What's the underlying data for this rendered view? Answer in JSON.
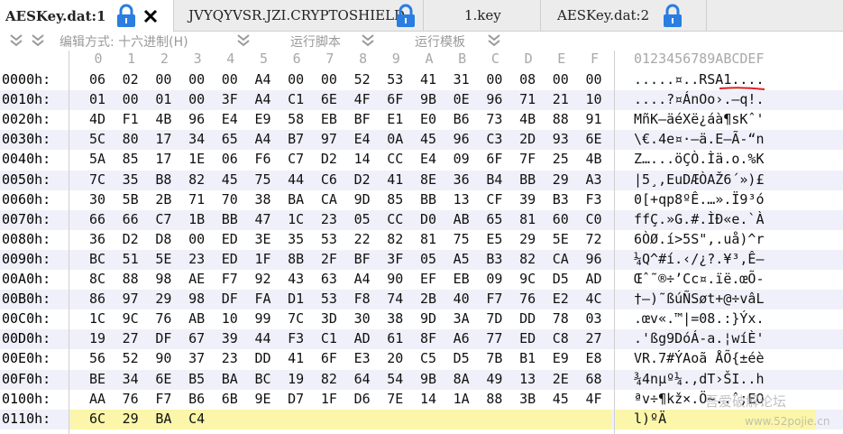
{
  "tabs": [
    {
      "label": "AESKey.dat:1",
      "active": true,
      "locked": true,
      "closable": true
    },
    {
      "label": "JVYQYVSR.JZI.CRYPTOSHIELD",
      "active": false,
      "locked": true
    },
    {
      "label": "1.key",
      "active": false,
      "locked": false
    },
    {
      "label": "AESKey.dat:2",
      "active": false,
      "locked": true
    }
  ],
  "toolbar": {
    "edit_mode": "编辑方式: 十六进制(H)",
    "run_script": "运行脚本",
    "run_template": "运行模板"
  },
  "column_header_hex": [
    "0",
    "1",
    "2",
    "3",
    "4",
    "5",
    "6",
    "7",
    "8",
    "9",
    "A",
    "B",
    "C",
    "D",
    "E",
    "F"
  ],
  "column_header_ascii": "0123456789ABCDEF",
  "rows": [
    {
      "offset": "0000h:",
      "hex": [
        "06",
        "02",
        "00",
        "00",
        "00",
        "A4",
        "00",
        "00",
        "52",
        "53",
        "41",
        "31",
        "00",
        "08",
        "00",
        "00"
      ],
      "ascii": ".....¤..RSA1...."
    },
    {
      "offset": "0010h:",
      "hex": [
        "01",
        "00",
        "01",
        "00",
        "3F",
        "A4",
        "C1",
        "6E",
        "4F",
        "6F",
        "9B",
        "0E",
        "96",
        "71",
        "21",
        "10"
      ],
      "ascii": "....?¤ÁnOo›.–q!."
    },
    {
      "offset": "0020h:",
      "hex": [
        "4D",
        "F1",
        "4B",
        "96",
        "E4",
        "E9",
        "58",
        "EB",
        "BF",
        "E1",
        "E0",
        "B6",
        "73",
        "4B",
        "88",
        "91"
      ],
      "ascii": "MñK–äéXë¿áà¶sKˆ'"
    },
    {
      "offset": "0030h:",
      "hex": [
        "5C",
        "80",
        "17",
        "34",
        "65",
        "A4",
        "B7",
        "97",
        "E4",
        "0A",
        "45",
        "96",
        "C3",
        "2D",
        "93",
        "6E"
      ],
      "ascii": "\\€.4e¤·—ä.E–Ã-“n"
    },
    {
      "offset": "0040h:",
      "hex": [
        "5A",
        "85",
        "17",
        "1E",
        "06",
        "F6",
        "C7",
        "D2",
        "14",
        "CC",
        "E4",
        "09",
        "6F",
        "7F",
        "25",
        "4B"
      ],
      "ascii": "Z…...öÇÒ.Ìä.o.%K"
    },
    {
      "offset": "0050h:",
      "hex": [
        "7C",
        "35",
        "B8",
        "82",
        "45",
        "75",
        "44",
        "C6",
        "D2",
        "41",
        "8E",
        "36",
        "B4",
        "BB",
        "29",
        "A3"
      ],
      "ascii": "|5¸‚EuDÆÒAŽ6´»)£"
    },
    {
      "offset": "0060h:",
      "hex": [
        "30",
        "5B",
        "2B",
        "71",
        "70",
        "38",
        "BA",
        "CA",
        "9D",
        "85",
        "BB",
        "13",
        "CF",
        "39",
        "B3",
        "F3"
      ],
      "ascii": "0[+qp8ºÊ.…».Ï9³ó"
    },
    {
      "offset": "0070h:",
      "hex": [
        "66",
        "66",
        "C7",
        "1B",
        "BB",
        "47",
        "1C",
        "23",
        "05",
        "CC",
        "D0",
        "AB",
        "65",
        "81",
        "60",
        "C0"
      ],
      "ascii": "ffÇ.»G.#.ÌÐ«e.`À"
    },
    {
      "offset": "0080h:",
      "hex": [
        "36",
        "D2",
        "D8",
        "00",
        "ED",
        "3E",
        "35",
        "53",
        "22",
        "82",
        "81",
        "75",
        "E5",
        "29",
        "5E",
        "72"
      ],
      "ascii": "6ÒØ.í>5S\"‚.uå)^r"
    },
    {
      "offset": "0090h:",
      "hex": [
        "BC",
        "51",
        "5E",
        "23",
        "ED",
        "1F",
        "8B",
        "2F",
        "BF",
        "3F",
        "05",
        "A5",
        "B3",
        "82",
        "CA",
        "96"
      ],
      "ascii": "¼Q^#í.‹/¿?.¥³‚Ê–"
    },
    {
      "offset": "00A0h:",
      "hex": [
        "8C",
        "88",
        "98",
        "AE",
        "F7",
        "92",
        "43",
        "63",
        "A4",
        "90",
        "EF",
        "EB",
        "09",
        "9C",
        "D5",
        "AD"
      ],
      "ascii": "Œˆ˜®÷’Cc¤.ïë.œÕ-"
    },
    {
      "offset": "00B0h:",
      "hex": [
        "86",
        "97",
        "29",
        "98",
        "DF",
        "FA",
        "D1",
        "53",
        "F8",
        "74",
        "2B",
        "40",
        "F7",
        "76",
        "E2",
        "4C"
      ],
      "ascii": "†—)˜ßúÑSøt+@÷vâL"
    },
    {
      "offset": "00C0h:",
      "hex": [
        "1C",
        "9C",
        "76",
        "AB",
        "10",
        "99",
        "7C",
        "3D",
        "30",
        "38",
        "9D",
        "3A",
        "7D",
        "DD",
        "78",
        "03"
      ],
      "ascii": ".œv«.™|=08.:}Ýx."
    },
    {
      "offset": "00D0h:",
      "hex": [
        "19",
        "27",
        "DF",
        "67",
        "39",
        "44",
        "F3",
        "C1",
        "AD",
        "61",
        "8F",
        "A6",
        "77",
        "ED",
        "C8",
        "27"
      ],
      "ascii": ".'ßg9DóÁ-a.¦wíÈ'"
    },
    {
      "offset": "00E0h:",
      "hex": [
        "56",
        "52",
        "90",
        "37",
        "23",
        "DD",
        "41",
        "6F",
        "E3",
        "20",
        "C5",
        "D5",
        "7B",
        "B1",
        "E9",
        "E8"
      ],
      "ascii": "VR.7#ÝAoã ÅÕ{±éè"
    },
    {
      "offset": "00F0h:",
      "hex": [
        "BE",
        "34",
        "6E",
        "B5",
        "BA",
        "BC",
        "19",
        "82",
        "64",
        "54",
        "9B",
        "8A",
        "49",
        "13",
        "2E",
        "68"
      ],
      "ascii": "¾4nµº¼.‚dT›ŠI..h"
    },
    {
      "offset": "0100h:",
      "hex": [
        "AA",
        "76",
        "F7",
        "B6",
        "6B",
        "9E",
        "D7",
        "1F",
        "D6",
        "7E",
        "14",
        "1A",
        "88",
        "3B",
        "45",
        "4F"
      ],
      "ascii": "ªv÷¶kž×.Ö~..ˆ;EO"
    },
    {
      "offset": "0110h:",
      "hex": [
        "6C",
        "29",
        "BA",
        "C4"
      ],
      "ascii": "l)ºÄ"
    }
  ],
  "watermark": {
    "line1": "吾爱破解论坛",
    "line2": "www.52pojie.cn"
  },
  "colors": {
    "accent_lock": "#2a7de1",
    "highlight": "#fbf6a9",
    "row_alt": "#f0f0fa",
    "underline": "#e02020"
  }
}
